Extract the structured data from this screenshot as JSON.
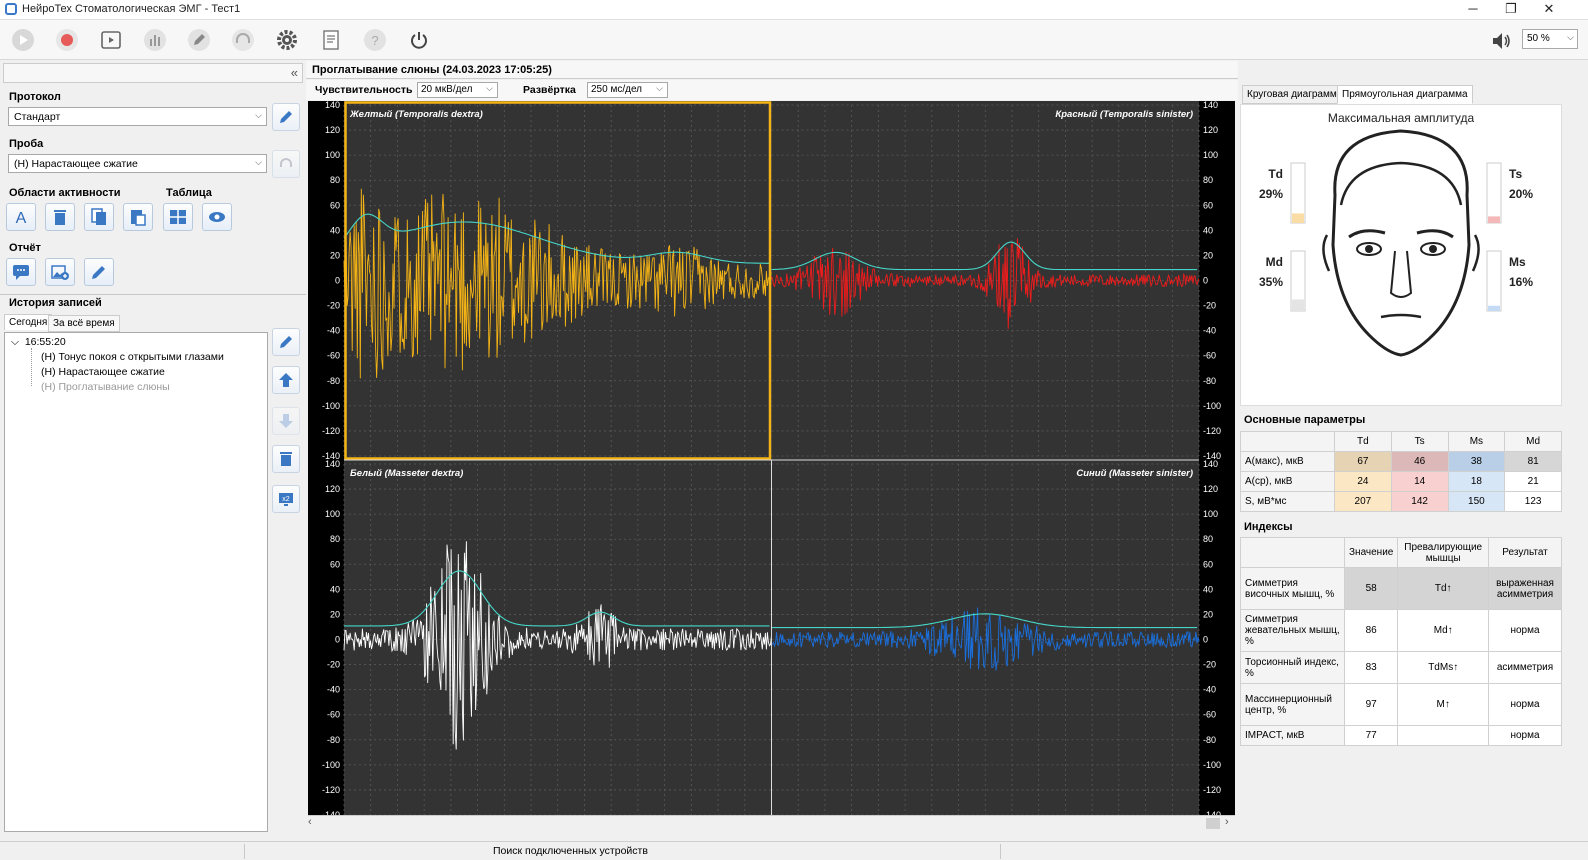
{
  "window": {
    "title": "НейроТех Стоматологическая ЭМГ  - Тест1",
    "controls": [
      "─",
      "❐",
      "✕"
    ]
  },
  "toolbar": {
    "buttons": [
      "play",
      "record",
      "playback",
      "bar-chart",
      "edit",
      "acoustic",
      "settings",
      "report",
      "help",
      "power"
    ],
    "volume_level": "50 %"
  },
  "left": {
    "protocol_label": "Протокол",
    "protocol_value": "Стандарт",
    "probe_label": "Проба",
    "probe_value": "(Н) Нарастающее сжатие",
    "activity_label": "Области активности",
    "table_label": "Таблица",
    "report_label": "Отчёт",
    "history_label": "История записей",
    "history_tabs": [
      "Сегодня",
      "За всё время"
    ],
    "tree": {
      "time": "16:55:20",
      "items": [
        {
          "text": "(Н) Тонус покоя с открытыми глазами",
          "muted": false
        },
        {
          "text": "(Н) Нарастающее сжатие",
          "muted": false
        },
        {
          "text": "(Н) Проглатывание слюны",
          "muted": true
        }
      ]
    }
  },
  "center": {
    "title": "Проглатывание слюны (24.03.2023 17:05:25)",
    "sensitivity_label": "Чувствительность",
    "sensitivity_value": "20 мкВ/дел",
    "sweep_label": "Развёртка",
    "sweep_value": "250 мс/дел",
    "y_ticks": [
      140,
      120,
      100,
      80,
      60,
      40,
      20,
      0,
      -20,
      -40,
      -60,
      -80,
      -100,
      -120,
      -140
    ],
    "channels": [
      {
        "name": "Желтый (Temporalis dextra)",
        "color": "#f5b416",
        "align": "left",
        "selected": true,
        "amp": 40,
        "seed": 11,
        "bursts": [
          [
            0.05,
            0.12,
            45
          ],
          [
            0.28,
            0.55,
            60
          ],
          [
            0.78,
            0.2,
            15
          ]
        ]
      },
      {
        "name": "Красный (Temporalis sinister)",
        "color": "#ee1c1c",
        "align": "right",
        "selected": false,
        "amp": 14,
        "seed": 23,
        "bursts": [
          [
            0.15,
            0.15,
            25
          ],
          [
            0.56,
            0.1,
            40
          ]
        ]
      },
      {
        "name": "Белый (Masseter dextra)",
        "color": "#ffffff",
        "align": "left",
        "selected": false,
        "amp": 25,
        "seed": 37,
        "bursts": [
          [
            0.27,
            0.16,
            80
          ],
          [
            0.6,
            0.1,
            20
          ]
        ]
      },
      {
        "name": "Синий (Masseter sinister)",
        "color": "#1a6fdc",
        "align": "right",
        "selected": false,
        "amp": 18,
        "seed": 51,
        "bursts": [
          [
            0.5,
            0.25,
            20
          ]
        ]
      }
    ]
  },
  "right": {
    "tabs": [
      "Круговая диаграмма",
      "Прямоугольная диаграмма"
    ],
    "diagram_title": "Максимальная амплитуда",
    "bars": [
      {
        "label": "Td",
        "pct": "29%",
        "value": 0.29,
        "color": "#f9dda5"
      },
      {
        "label": "Ts",
        "pct": "20%",
        "value": 0.2,
        "color": "#f5b8b8"
      },
      {
        "label": "Md",
        "pct": "35%",
        "value": 0.35,
        "color": "#e4e4e4"
      },
      {
        "label": "Ms",
        "pct": "16%",
        "value": 0.16,
        "color": "#c5dbf5"
      }
    ],
    "params_title": "Основные параметры",
    "params_head": [
      "",
      "Td",
      "Ts",
      "Ms",
      "Md"
    ],
    "params_rows": [
      {
        "label": "А(макс), мкВ",
        "v": [
          "67",
          "46",
          "38",
          "81"
        ],
        "bg": [
          "#e6d3b4",
          "#ddb8b8",
          "#b9cfe7",
          "#d6d6d6"
        ]
      },
      {
        "label": "А(ср), мкВ",
        "v": [
          "24",
          "14",
          "18",
          "21"
        ],
        "bg": [
          "#fbe7c4",
          "#f8d0d0",
          "#d7e6f7",
          "#ffffff"
        ]
      },
      {
        "label": "S, мВ*мс",
        "v": [
          "207",
          "142",
          "150",
          "123"
        ],
        "bg": [
          "#fbe7c4",
          "#f8d0d0",
          "#d7e6f7",
          "#ffffff"
        ]
      }
    ],
    "indexes_title": "Индексы",
    "idx_head": [
      "",
      "Значение",
      "Превалирующие мышцы",
      "Результат"
    ],
    "idx_rows": [
      {
        "label": "Симметрия височных мышц, %",
        "value": "58",
        "muscles": "Td↑",
        "result": "выраженная асимметрия",
        "hl": true
      },
      {
        "label": "Симметрия жевательных мышц, %",
        "value": "86",
        "muscles": "Md↑",
        "result": "норма",
        "hl": false
      },
      {
        "label": "Торсионный индекс, %",
        "value": "83",
        "muscles": "TdMs↑",
        "result": "асимметрия",
        "hl": false
      },
      {
        "label": "Массинерционный центр, %",
        "value": "97",
        "muscles": "M↑",
        "result": "норма",
        "hl": false
      },
      {
        "label": "IMPACT, мкВ",
        "value": "77",
        "muscles": "",
        "result": "норма",
        "hl": false
      }
    ]
  },
  "status": {
    "text": "Поиск подключенных устройств"
  }
}
